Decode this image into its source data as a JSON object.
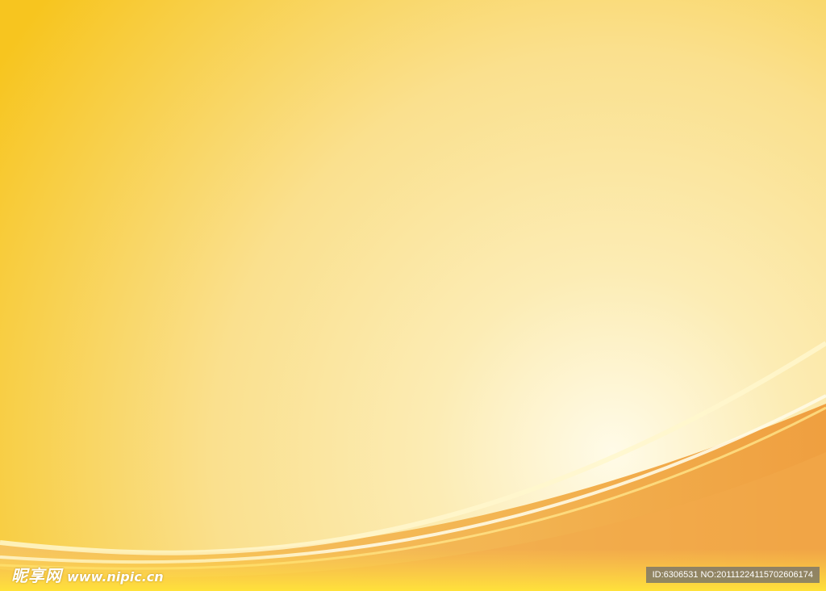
{
  "background": {
    "colors": {
      "top_left": "#f7c51f",
      "glow": "#fffbe8",
      "mid": "#fae08e",
      "lower_band": "#f0a443",
      "bottom_yellow": "#ffe23a"
    }
  },
  "watermark": {
    "brand": "昵享网",
    "url": "www.nipic.cn",
    "id_label": "ID:6306531 NO:20111224115702606174"
  }
}
